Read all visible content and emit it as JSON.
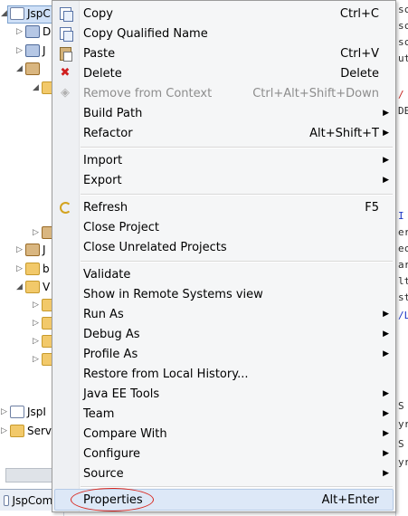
{
  "explorer": {
    "project_label": "JspC",
    "items": [
      {
        "label": "D",
        "icon": "library-icon"
      },
      {
        "label": "J",
        "icon": "library-icon"
      },
      {
        "label": "J",
        "icon": "jar-icon"
      },
      {
        "label": "J",
        "icon": "jar-icon"
      },
      {
        "label": "b",
        "icon": "folder-icon"
      },
      {
        "label": "V",
        "icon": "folder-icon"
      },
      {
        "label": "JspI",
        "icon": "project-icon"
      },
      {
        "label": "Serv",
        "icon": "project-icon"
      }
    ],
    "bottom_tab": "JspComm"
  },
  "context_menu": {
    "items": [
      {
        "id": "copy",
        "label": "Copy",
        "accel": "Ctrl+C",
        "icon": "copy-icon"
      },
      {
        "id": "copy-qualified-name",
        "label": "Copy Qualified Name",
        "accel": "",
        "icon": "copy-icon"
      },
      {
        "id": "paste",
        "label": "Paste",
        "accel": "Ctrl+V",
        "icon": "paste-icon"
      },
      {
        "id": "delete",
        "label": "Delete",
        "accel": "Delete",
        "icon": "delete-icon"
      },
      {
        "id": "remove-from-context",
        "label": "Remove from Context",
        "accel": "Ctrl+Alt+Shift+Down",
        "icon": "remove-context-icon",
        "disabled": true
      },
      {
        "id": "build-path",
        "label": "Build Path",
        "accel": "",
        "submenu": true
      },
      {
        "id": "refactor",
        "label": "Refactor",
        "accel": "Alt+Shift+T",
        "submenu": true
      },
      {
        "id": "import",
        "label": "Import",
        "accel": "",
        "submenu": true
      },
      {
        "id": "export",
        "label": "Export",
        "accel": "",
        "submenu": true
      },
      {
        "id": "refresh",
        "label": "Refresh",
        "accel": "F5",
        "icon": "refresh-icon"
      },
      {
        "id": "close-project",
        "label": "Close Project",
        "accel": ""
      },
      {
        "id": "close-unrelated-projects",
        "label": "Close Unrelated Projects",
        "accel": ""
      },
      {
        "id": "validate",
        "label": "Validate",
        "accel": ""
      },
      {
        "id": "show-in-remote-systems-view",
        "label": "Show in Remote Systems view",
        "accel": ""
      },
      {
        "id": "run-as",
        "label": "Run As",
        "accel": "",
        "submenu": true
      },
      {
        "id": "debug-as",
        "label": "Debug As",
        "accel": "",
        "submenu": true
      },
      {
        "id": "profile-as",
        "label": "Profile As",
        "accel": "",
        "submenu": true
      },
      {
        "id": "restore-from-local-history",
        "label": "Restore from Local History...",
        "accel": ""
      },
      {
        "id": "java-ee-tools",
        "label": "Java EE Tools",
        "accel": "",
        "submenu": true
      },
      {
        "id": "team",
        "label": "Team",
        "accel": "",
        "submenu": true
      },
      {
        "id": "compare-with",
        "label": "Compare With",
        "accel": "",
        "submenu": true
      },
      {
        "id": "configure",
        "label": "Configure",
        "accel": "",
        "submenu": true
      },
      {
        "id": "source",
        "label": "Source",
        "accel": "",
        "submenu": true
      },
      {
        "id": "properties",
        "label": "Properties",
        "accel": "Alt+Enter",
        "highlighted": true
      }
    ],
    "submenu_arrow": "▶"
  },
  "editor": {
    "lines": [
      "sc",
      "sc",
      "sc",
      "ut",
      "/",
      "DE",
      "I",
      "er",
      "ec",
      "ar",
      "lt",
      "st",
      "/L",
      "S",
      "yr",
      "S",
      "yr"
    ]
  },
  "colors": {
    "highlight_annotation": "#d9281f",
    "menu_background": "#f5f6f7",
    "selection": "#dde8f7"
  }
}
